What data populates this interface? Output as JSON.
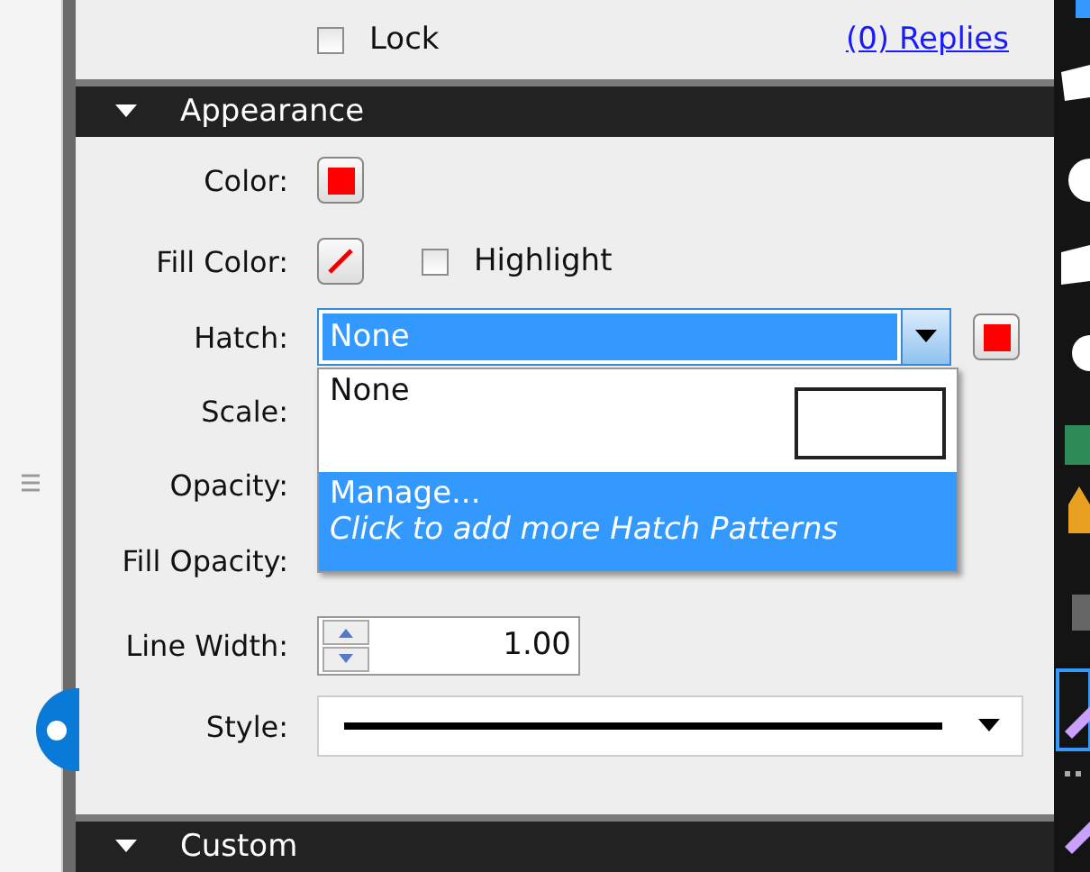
{
  "top_row": {
    "lock": {
      "label": "Lock",
      "checked": false
    },
    "replies_link": "(0) Replies"
  },
  "sections": [
    {
      "title": "Appearance",
      "expanded": true
    },
    {
      "title": "Custom",
      "expanded": true
    }
  ],
  "appearance": {
    "color": {
      "label": "Color:",
      "color": "#ff0000"
    },
    "fill_color": {
      "label": "Fill Color:",
      "none": true
    },
    "highlight": {
      "label": "Highlight",
      "checked": false
    },
    "hatch": {
      "label": "Hatch:",
      "value": "None",
      "expanded": true,
      "color": "#ff0000",
      "options": [
        {
          "label": "None",
          "highlighted": false
        },
        {
          "label": "Manage...",
          "hint": "Click to add more Hatch Patterns",
          "highlighted": true
        }
      ]
    },
    "scale": {
      "label": "Scale:"
    },
    "opacity": {
      "label": "Opacity:"
    },
    "fill_opacity": {
      "label": "Fill Opacity:"
    },
    "line_width": {
      "label": "Line Width:",
      "value": "1.00"
    },
    "style": {
      "label": "Style:"
    }
  }
}
